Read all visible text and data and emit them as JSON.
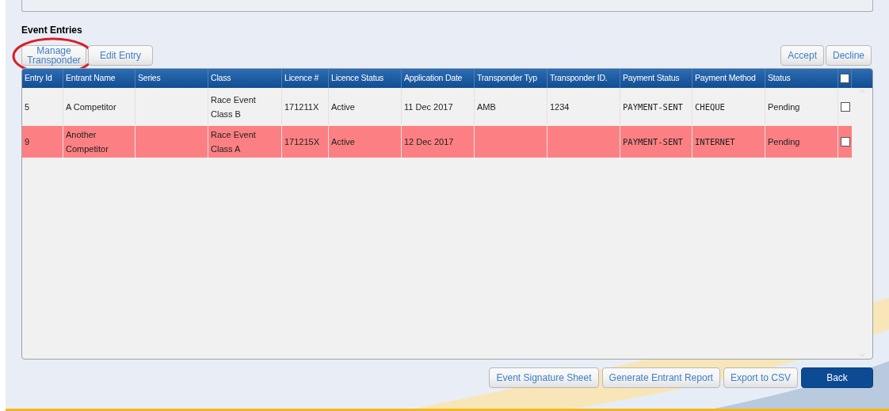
{
  "section_title": "Event Entries",
  "left_buttons": [
    {
      "label": "Manage Transponder",
      "circled": true
    },
    {
      "label": "Edit Entry",
      "circled": false
    }
  ],
  "right_buttons": [
    "Accept",
    "Decline"
  ],
  "table": {
    "columns": [
      "Entry Id",
      "Entrant Name",
      "Series",
      "Class",
      "Licence #",
      "Licence Status",
      "Application Date",
      "Transponder Typ",
      "Transponder ID.",
      "Payment Status",
      "Payment Method",
      "Status"
    ],
    "header_checked": false,
    "rows": [
      {
        "cells": [
          "5",
          "A Competitor",
          "",
          "Race Event Class B",
          "171211X",
          "Active",
          "11 Dec 2017",
          "AMB",
          "1234",
          "PAYMENT-SENT",
          "CHEQUE",
          "Pending"
        ],
        "highlighted": false,
        "checked": false
      },
      {
        "cells": [
          "9",
          "Another Competitor",
          "",
          "Race Event Class A",
          "171215X",
          "Active",
          "12 Dec 2017",
          "",
          "",
          "PAYMENT-SENT",
          "INTERNET",
          "Pending"
        ],
        "highlighted": true,
        "checked": false
      }
    ]
  },
  "bottom_buttons": [
    {
      "label": "Event Signature Sheet",
      "primary": false
    },
    {
      "label": "Generate Entrant Report",
      "primary": false
    },
    {
      "label": "Export to CSV",
      "primary": false
    },
    {
      "label": "Back",
      "primary": true
    }
  ]
}
